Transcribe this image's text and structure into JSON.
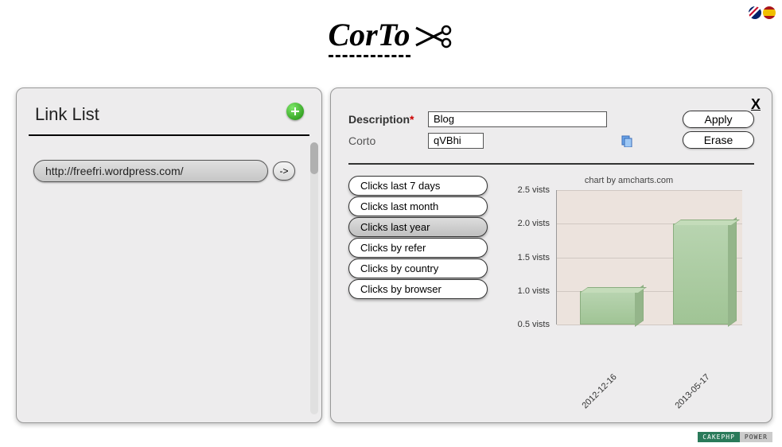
{
  "logo_text": "CorTo",
  "flags": {
    "en": "English",
    "es": "Español"
  },
  "sidebar": {
    "title": "Link List",
    "links": [
      {
        "url": "http://freefri.wordpress.com/",
        "arrow": "->"
      }
    ]
  },
  "detail": {
    "close": "X",
    "description_label": "Description",
    "required_marker": "*",
    "description_value": "Blog",
    "corto_label": "Corto",
    "corto_value": "qVBhi",
    "apply_label": "Apply",
    "erase_label": "Erase",
    "filters": [
      {
        "label": "Clicks last 7 days",
        "active": false
      },
      {
        "label": "Clicks last month",
        "active": false
      },
      {
        "label": "Clicks last year",
        "active": true
      },
      {
        "label": "Clicks by refer",
        "active": false
      },
      {
        "label": "Clicks by country",
        "active": false
      },
      {
        "label": "Clicks by browser",
        "active": false
      }
    ],
    "chart_credit": "chart by amcharts.com"
  },
  "chart_data": {
    "type": "bar",
    "categories": [
      "2012-12-16",
      "2013-05-17"
    ],
    "values": [
      1.0,
      2.0
    ],
    "ylabel_suffix": "vists",
    "ylim": [
      0.5,
      2.5
    ],
    "yticks": [
      0.5,
      1.0,
      1.5,
      2.0,
      2.5
    ]
  },
  "footer": {
    "left": "CAKEPHP",
    "right": "POWER"
  }
}
